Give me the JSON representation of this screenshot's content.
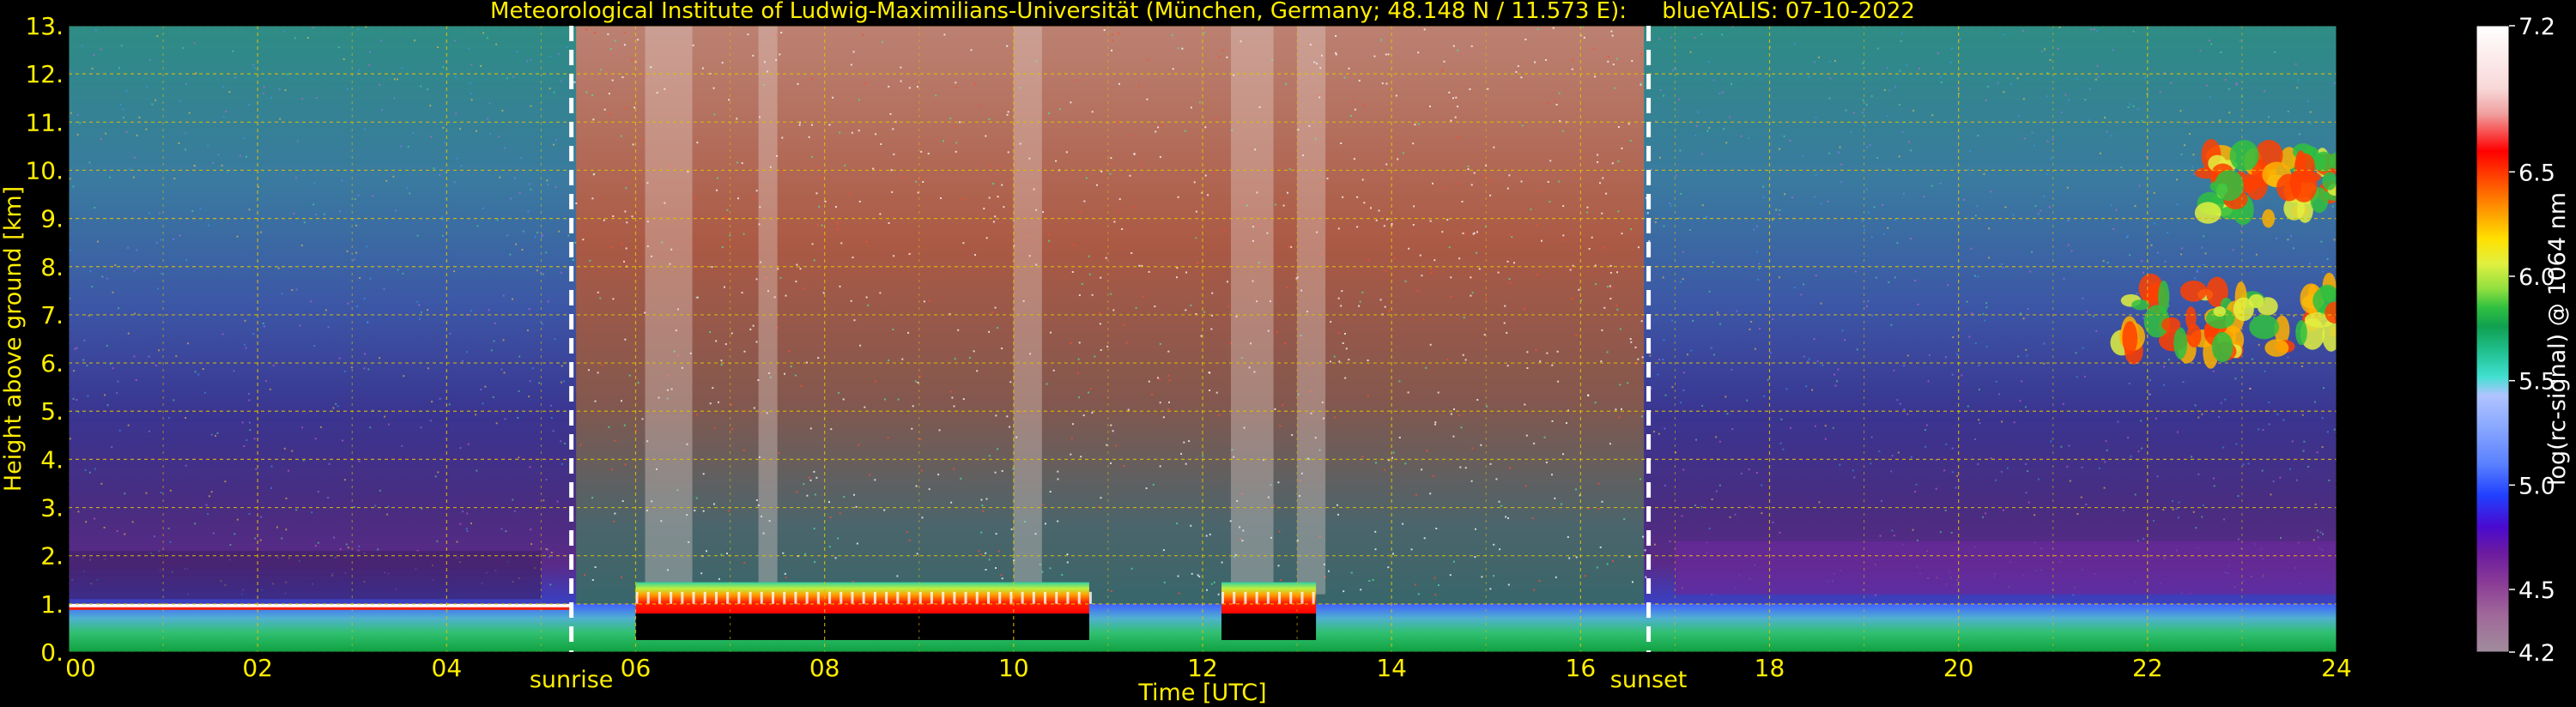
{
  "chart_data": {
    "type": "heatmap",
    "title": "Meteorological Institute of Ludwig-Maximilians-Universität (München, Germany; 48.148 N / 11.573 E):     blueYALIS: 07-10-2022",
    "xlabel": "Time [UTC]",
    "ylabel": "Height above ground [km]",
    "xlim": [
      0,
      24
    ],
    "ylim": [
      0,
      13
    ],
    "x_ticks": [
      "00",
      "02",
      "04",
      "06",
      "08",
      "10",
      "12",
      "14",
      "16",
      "18",
      "20",
      "22",
      "24"
    ],
    "y_ticks": [
      "0.",
      "1.",
      "2.",
      "3.",
      "4.",
      "5.",
      "6.",
      "7.",
      "8.",
      "9.",
      "10.",
      "11.",
      "12.",
      "13."
    ],
    "grid": true,
    "annotations": [
      {
        "label": "sunrise",
        "time": 5.32
      },
      {
        "label": "sunset",
        "time": 16.72
      }
    ],
    "colorbar": {
      "label": "log(rc-signal) @ 1064 nm",
      "range": [
        4.2,
        7.2
      ],
      "ticks": [
        "4.2",
        "4.5",
        "5.0",
        "5.5",
        "6.0",
        "6.5",
        "7.2"
      ],
      "tick_values": [
        4.2,
        4.5,
        5.0,
        5.5,
        6.0,
        6.5,
        7.2
      ],
      "colors": [
        "#a08c9c",
        "#a0689a",
        "#8a3c96",
        "#6a1aa0",
        "#4a0ad0",
        "#2040ff",
        "#5a80ff",
        "#8aa8ff",
        "#b0c4ff",
        "#40e0d0",
        "#20c090",
        "#10a050",
        "#30c040",
        "#90e040",
        "#e0f040",
        "#ffe000",
        "#ffb000",
        "#ff8000",
        "#ff4000",
        "#ff0000",
        "#f0a0a0",
        "#f8d8d8",
        "#ffffff"
      ]
    },
    "features": [
      {
        "name": "boundary layer top (aerosol)",
        "start": 0,
        "end": 5.3,
        "height_km": 0.95
      },
      {
        "name": "cloud base",
        "start": 6.0,
        "end": 10.8,
        "height_km": 0.9
      },
      {
        "name": "cloud base",
        "start": 12.2,
        "end": 13.2,
        "height_km": 0.9
      },
      {
        "name": "cirrus",
        "start": 22.6,
        "end": 24,
        "height_km": 9.8
      },
      {
        "name": "cirrus",
        "start": 21.7,
        "end": 24,
        "height_km": 7.0
      }
    ],
    "signal_colors": {
      "background_night": "#3a2a7a",
      "background_day": "#b0503a",
      "text": "#ffee00",
      "grid": "#e0c000"
    }
  }
}
